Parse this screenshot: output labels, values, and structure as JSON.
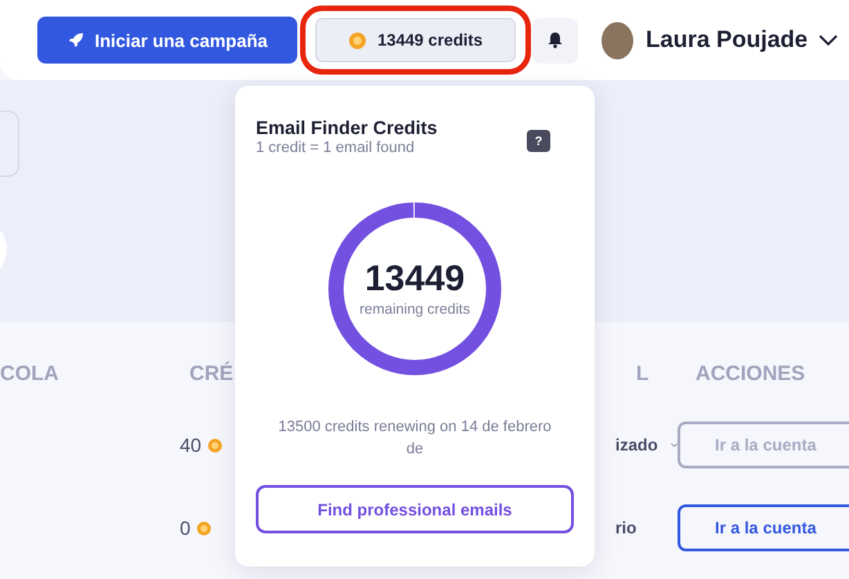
{
  "header": {
    "campaign_button": "Iniciar una campaña",
    "credits_button": {
      "label": "13449 credits",
      "highlighted": true
    },
    "user_name": "Laura Poujade"
  },
  "table": {
    "columns": [
      "COLA",
      "CRÉ",
      "L",
      "ACCIONES"
    ],
    "rows": [
      {
        "credits": "40",
        "column_3": "izado",
        "column_3_dropdown": true,
        "action": "Ir a la cuenta",
        "disabled": true
      },
      {
        "credits": "0",
        "column_3": "rio",
        "column_3_dropdown": false,
        "action": "Ir a la cuenta",
        "disabled": false
      }
    ]
  },
  "credits_popover": {
    "title": "Email Finder Credits",
    "subtitle": "1 credit = 1 email found",
    "help": "?",
    "remaining": "13449",
    "remaining_label": "remaining credits",
    "level": 0.996,
    "renewal": "13500 credits renewing on 14 de febrero de",
    "button": "Find professional emails"
  }
}
